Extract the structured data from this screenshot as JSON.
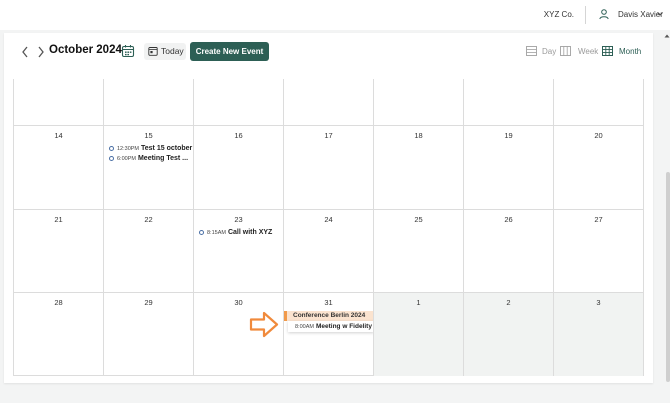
{
  "header": {
    "company": "XYZ Co.",
    "user_name": "Davis Xavier"
  },
  "toolbar": {
    "month_title": "October 2024",
    "today_label": "Today",
    "create_label": "Create New Event",
    "views": {
      "day": "Day",
      "week": "Week",
      "month": "Month"
    },
    "active_view": "month"
  },
  "colors": {
    "brand": "#2d5f55",
    "allday_bg": "#fbe3cf",
    "allday_accent": "#f19a4a",
    "arrow": "#f08a3c",
    "event_dot": "#4a6fa5"
  },
  "calendar": {
    "rows": [
      [
        {
          "day": "",
          "other": false
        },
        {
          "day": "",
          "other": false
        },
        {
          "day": "",
          "other": false
        },
        {
          "day": "",
          "other": false
        },
        {
          "day": "",
          "other": false
        },
        {
          "day": "",
          "other": false
        },
        {
          "day": "",
          "other": false
        }
      ],
      [
        {
          "day": "14",
          "other": false
        },
        {
          "day": "15",
          "other": false,
          "events": [
            {
              "time": "12:30PM",
              "title": "Test 15 october"
            },
            {
              "time": "6:00PM",
              "title": "Meeting Test ..."
            }
          ]
        },
        {
          "day": "16",
          "other": false
        },
        {
          "day": "17",
          "other": false
        },
        {
          "day": "18",
          "other": false
        },
        {
          "day": "19",
          "other": false
        },
        {
          "day": "20",
          "other": false
        }
      ],
      [
        {
          "day": "21",
          "other": false
        },
        {
          "day": "22",
          "other": false
        },
        {
          "day": "23",
          "other": false,
          "events": [
            {
              "time": "8:15AM",
              "title": "Call with XYZ"
            }
          ]
        },
        {
          "day": "24",
          "other": false
        },
        {
          "day": "25",
          "other": false
        },
        {
          "day": "26",
          "other": false
        },
        {
          "day": "27",
          "other": false
        }
      ],
      [
        {
          "day": "28",
          "other": false
        },
        {
          "day": "29",
          "other": false
        },
        {
          "day": "30",
          "other": false
        },
        {
          "day": "31",
          "other": false,
          "allday": "Conference Berlin 2024",
          "timed": {
            "time": "8:00AM",
            "title": "Meeting w Fidelity"
          }
        },
        {
          "day": "1",
          "other": true
        },
        {
          "day": "2",
          "other": true
        },
        {
          "day": "3",
          "other": true
        }
      ]
    ]
  }
}
